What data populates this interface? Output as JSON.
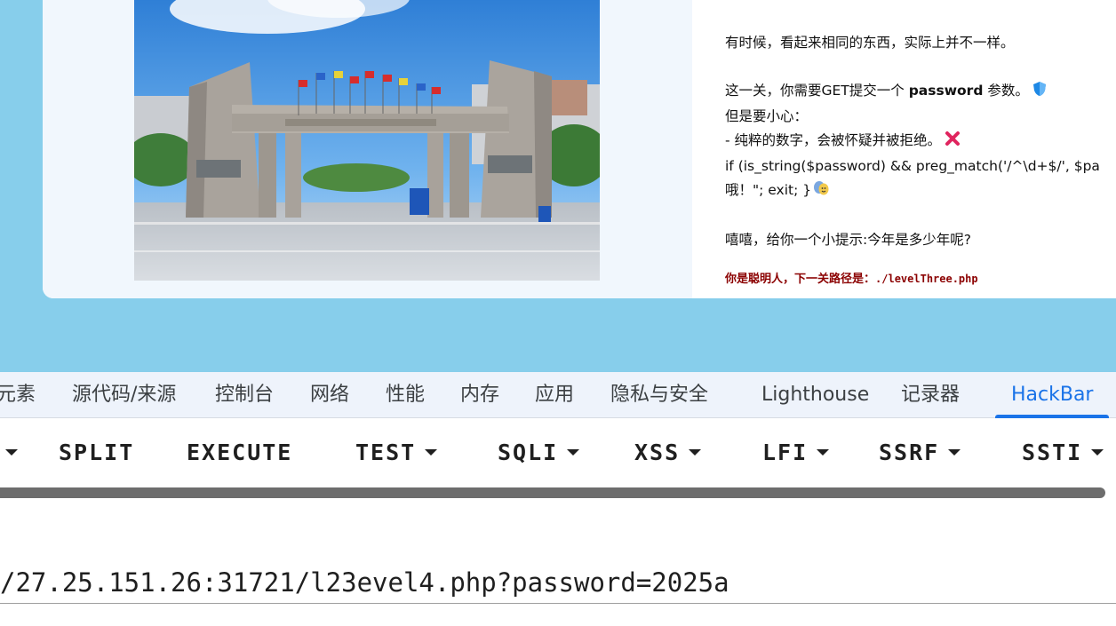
{
  "page": {
    "paragraphs": {
      "line1": "有时候，看起来相同的东西，实际上并不一样。",
      "line2_pre": "这一关，你需要GET提交一个 ",
      "line2_bold": "password",
      "line2_post": " 参数。",
      "line3": "但是要小心：",
      "line4": "- 纯粹的数字，会被怀疑并被拒绝。",
      "line5": "if (is_string($password) && preg_match('/^\\d+$/', $pa",
      "line6": "哦！\"; exit; }",
      "line7": "嘻嘻，给你一个小提示:今年是多少年呢?",
      "hint_prefix": "你是聪明人，下一关路径是：",
      "hint_path": "./levelThree.php"
    },
    "icons": [
      "shield-icon",
      "cross-mark-icon",
      "theater-masks-icon"
    ]
  },
  "devtools": {
    "tabs": [
      "元素",
      "源代码/来源",
      "控制台",
      "网络",
      "性能",
      "内存",
      "应用",
      "隐私与安全",
      "Lighthouse",
      "记录器",
      "HackBar"
    ],
    "active_tab": "HackBar",
    "accent": "#1a73e8"
  },
  "hackbar": {
    "buttons": [
      "SPLIT",
      "EXECUTE",
      "TEST",
      "SQLI",
      "XSS",
      "LFI",
      "SSRF",
      "SSTI"
    ],
    "url_value": "/27.25.151.26:31721/l23evel4.php?password=2025a"
  },
  "colors": {
    "page_background": "#87ceeb",
    "hint_text": "#8b0000"
  }
}
